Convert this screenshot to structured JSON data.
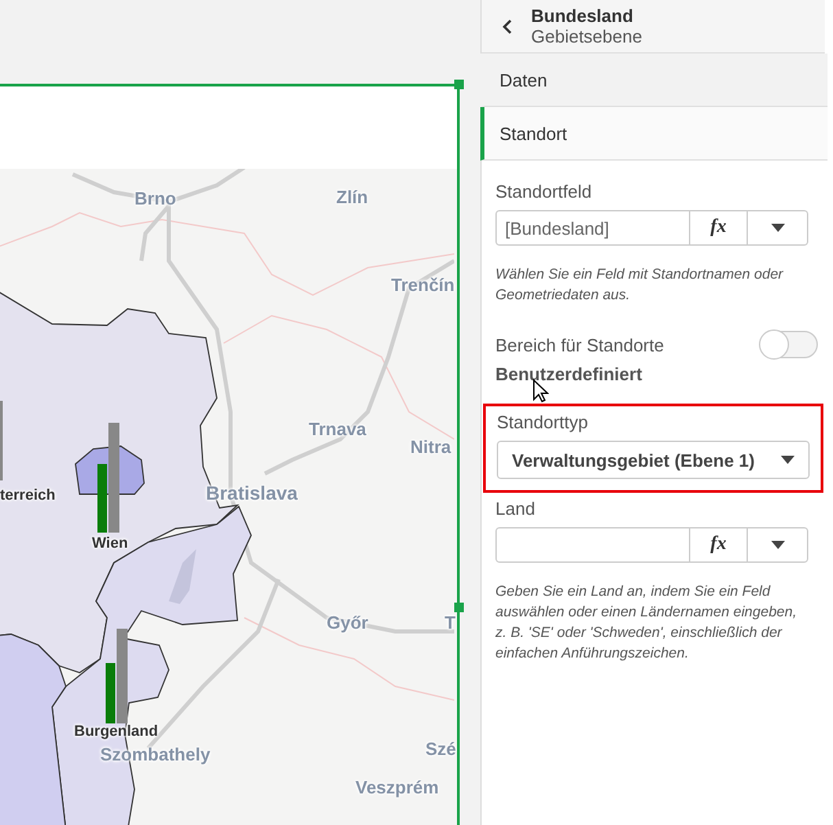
{
  "map": {
    "places": [
      {
        "kind": "city",
        "name": "Brno"
      },
      {
        "kind": "city",
        "name": "Zlín"
      },
      {
        "kind": "city",
        "name": "Trenčín"
      },
      {
        "kind": "city",
        "name": "Trnava"
      },
      {
        "kind": "city",
        "name": "Nitra"
      },
      {
        "kind": "capital",
        "name": "Bratislava"
      },
      {
        "kind": "city",
        "name": "Győr"
      },
      {
        "kind": "city",
        "name": "T"
      },
      {
        "kind": "city",
        "name": "Szombathely"
      },
      {
        "kind": "city",
        "name": "Szé"
      },
      {
        "kind": "city",
        "name": "Veszprém"
      },
      {
        "kind": "region",
        "name": "terreich"
      },
      {
        "kind": "region",
        "name": "Wien"
      },
      {
        "kind": "region",
        "name": "Burgenland"
      }
    ]
  },
  "panel": {
    "title": "Bundesland",
    "subtitle": "Gebietsebene",
    "sections": [
      {
        "label": "Daten",
        "selected": false
      },
      {
        "label": "Standort",
        "selected": true
      }
    ],
    "location_field": {
      "label": "Standortfeld",
      "value": "[Bundesland]",
      "fx": "fx",
      "hint": "Wählen Sie ein Feld mit Standortnamen oder Geometriedaten aus."
    },
    "range": {
      "label": "Bereich für Standorte",
      "value": "Benutzerdefiniert",
      "on": false
    },
    "location_type": {
      "label": "Standorttyp",
      "value": "Verwaltungsgebiet (Ebene 1)",
      "highlighted": true
    },
    "country": {
      "label": "Land",
      "fx": "fx",
      "hint": "Geben Sie ein Land an, indem Sie ein Feld auswählen oder einen Ländernamen eingeben, z. B. 'SE' oder 'Schweden', einschließlich der einfachen Anführungszeichen."
    }
  }
}
